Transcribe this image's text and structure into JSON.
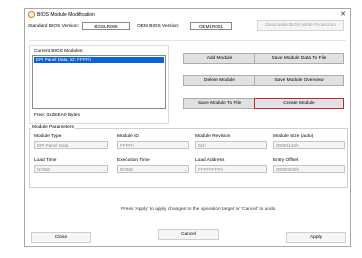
{
  "window": {
    "title": "BIOS Module Modification"
  },
  "header": {
    "std_bios_label": "Standard BIOS Version:",
    "std_bios_value": "BGSLR009",
    "oem_bios_label": "OEM BIOS Version:",
    "oem_bios_value": "OEM1R001",
    "deactivate_label": "Deactivate BIOS Write Protection"
  },
  "modules": {
    "label": "Current BIOS Modules:",
    "items": [
      "EPI Panel Data, ID: FFFFh"
    ],
    "free_label": "Free: 0x2EEA0 Bytes"
  },
  "buttons": {
    "add": "Add Module",
    "save_to_file": "Save Module Data To File",
    "delete": "Delete Module",
    "save_overview": "Save Module Overview",
    "save_module": "Save Module To File",
    "create": "Create Module",
    "close": "Close",
    "cancel": "Cancel",
    "apply": "Apply"
  },
  "params": {
    "group_label": "Module Parameters",
    "module_type_label": "Module Type",
    "module_type_value": "EPI Panel Data",
    "module_id_label": "Module ID",
    "module_id_value": "FFFFh",
    "module_rev_label": "Module Revision",
    "module_rev_value": "01h",
    "module_size_label": "Module Size (auto)",
    "module_size_value": "00001134h",
    "load_time_label": "Load Time",
    "load_time_value": "NONE",
    "exec_time_label": "Execution Time",
    "exec_time_value": "NONE",
    "load_addr_label": "Load Address",
    "load_addr_value": "FFFFFFFFh",
    "entry_offset_label": "Entry Offset",
    "entry_offset_value": "00000000h"
  },
  "hint": "Press 'Apply' to apply changes to the operation target or 'Cancel' to undo."
}
